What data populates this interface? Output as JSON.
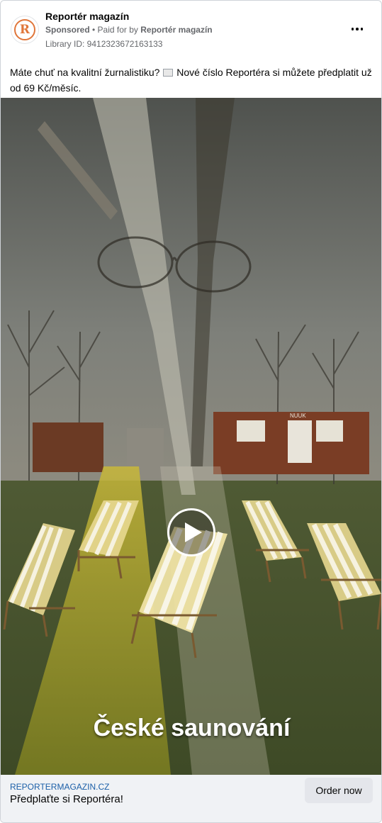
{
  "ad": {
    "page_name": "Reportér magazín",
    "avatar_letter": "R",
    "sponsored_label": "Sponsored",
    "separator": " • ",
    "paid_for_prefix": "Paid for by ",
    "paid_for_name": "Reportér magazín",
    "library_id": "Library ID: 9412323672163133",
    "body_part1": "Máte chuť na kvalitní žurnalistiku? ",
    "body_part2": " Nové číslo Reportéra si můžete předplatit už od 69 Kč/měsíc.",
    "body_icon": "newspaper-icon"
  },
  "media": {
    "type": "video",
    "caption": "České saunování",
    "sign_text": "NUUK",
    "accent": "#e0763a"
  },
  "footer": {
    "domain": "REPORTERMAGAZIN.CZ",
    "title": "Předplaťte si Reportéra!",
    "cta_label": "Order now"
  }
}
